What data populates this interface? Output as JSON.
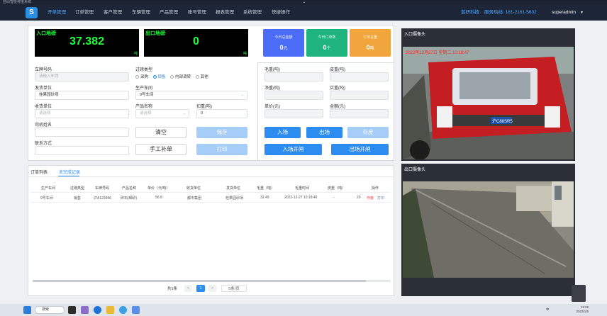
{
  "window": {
    "title": "蓝研智能称重系统",
    "chevron": "⌄"
  },
  "nav": {
    "logo_icon": "logo-icon",
    "items": [
      "开单管理",
      "订单管理",
      "客户管理",
      "车辆管理",
      "产品管理",
      "账号管理",
      "报表管理",
      "系统管理",
      "快捷操作"
    ],
    "company": "蓝研科技",
    "phone": "服务热线: 181-2161-5632",
    "user": "superadmin",
    "caret": "▼"
  },
  "displays": {
    "in": {
      "label": "入口地磅",
      "value": "37.382",
      "unit": "吨"
    },
    "out": {
      "label": "出口地磅",
      "value": "0",
      "unit": "吨"
    }
  },
  "stats": [
    {
      "label": "今日总金额",
      "value": "0",
      "unit": "元",
      "color": "#4a6cf7"
    },
    {
      "label": "今日订单数",
      "value": "0",
      "unit": "个",
      "color": "#1fb37e"
    },
    {
      "label": "订单总重",
      "value": "0",
      "unit": "吨",
      "color": "#f0a63c"
    }
  ],
  "form": {
    "plate": {
      "label": "车牌号码",
      "placeholder": "请输入车牌"
    },
    "weigh_type": {
      "label": "过磅类型",
      "options": [
        {
          "label": "采购",
          "checked": false
        },
        {
          "label": "销售",
          "checked": true
        },
        {
          "label": "内部调转",
          "checked": false
        },
        {
          "label": "其他",
          "checked": false
        }
      ]
    },
    "ship_unit": {
      "label": "发货单位",
      "value": "桂果园砂场"
    },
    "workshop": {
      "label": "生产车间",
      "value": "9号车间",
      "arrow": "⌄"
    },
    "recv_unit": {
      "label": "收货单位",
      "placeholder": "请选择"
    },
    "product": {
      "label": "产品名称",
      "placeholder": "请选择",
      "arrow": "⌄"
    },
    "deduct": {
      "label": "扣重(吨)",
      "value": "0"
    },
    "driver": {
      "label": "司机姓名"
    },
    "contact": {
      "label": "联系方式"
    },
    "buttons": {
      "clear": "清空",
      "save": "保存",
      "manual": "手工补单",
      "print": "打印"
    }
  },
  "weights": {
    "gross": "毛重(吨)",
    "tare": "皮重(吨)",
    "net": "净重(吨)",
    "actual": "实重(吨)",
    "price": "单价(元)",
    "amount": "金额(元)",
    "buttons": {
      "enter": "入场",
      "exit": "出场",
      "tare_save": "存皮",
      "open_in": "入场开闸",
      "open_out": "出场开闸"
    }
  },
  "table": {
    "tabs": [
      "订单列表",
      "未完成记录"
    ],
    "columns": [
      "生产车间",
      "过磅类型",
      "车牌号码",
      "产品名称",
      "单价（元/吨）",
      "收货单位",
      "发货单位",
      "毛重（吨）",
      "毛重时间",
      "皮重（吨）",
      "操作"
    ],
    "row": [
      "9号车间",
      "销售",
      "沪A123456",
      "碎石(细砂)",
      "56.8",
      "都市集团",
      "桂果园砂场",
      "32.49",
      "2022-12-27 10:18:46",
      "-",
      "20"
    ],
    "actions": [
      "作废",
      "打印"
    ]
  },
  "pager": {
    "total": "共1条",
    "prev": "<",
    "page": "1",
    "next": ">",
    "size": "5条/页"
  },
  "cameras": {
    "in": {
      "title": "入口摄像头",
      "overlay": "2022年12月27日 星期二 10:18:47"
    },
    "out": {
      "title": "出口摄像头"
    },
    "plate_text": "沪C88SR5"
  },
  "taskbar": {
    "search": "搜索",
    "lang": "中",
    "time": "11:22",
    "date": "2023/1/5"
  }
}
